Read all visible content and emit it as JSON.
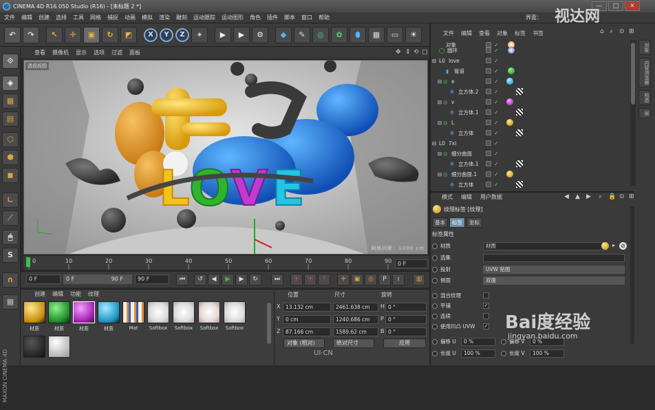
{
  "window": {
    "title": "CINEMA 4D R16.050 Studio (R16) - [未标题 2 *]",
    "min_label": "—",
    "max_label": "□",
    "close_label": "✕"
  },
  "menubar": [
    "文件",
    "编辑",
    "创建",
    "选择",
    "工具",
    "网格",
    "捕捉",
    "动画",
    "模拟",
    "渲染",
    "雕刻",
    "运动跟踪",
    "运动图形",
    "角色",
    "插件",
    "脚本",
    "窗口",
    "帮助"
  ],
  "menubar_right": "界面：",
  "toolbar": {
    "icons": [
      "undo-icon",
      "arrow-icon",
      "move-icon",
      "scale-icon",
      "rotate-icon",
      "live-select-icon",
      "x-axis-icon",
      "y-axis-icon",
      "z-axis-icon",
      "world-coord-icon",
      "render-view-icon",
      "render-picture-icon",
      "render-settings-icon",
      "cube-icon",
      "pen-icon",
      "subdivision-icon",
      "array-icon",
      "deformer-icon",
      "floor-icon",
      "camera-icon",
      "light-icon"
    ],
    "x_label": "X",
    "y_label": "Y",
    "z_label": "Z"
  },
  "viewport": {
    "menu": [
      "查看",
      "摄像机",
      "显示",
      "选项",
      "过滤",
      "面板"
    ],
    "label": "透视视图",
    "distance": "网格间距：1000 cm",
    "scene_text_top": "七夕",
    "scene_text_main": "LOVE",
    "letter_colors": {
      "L": "#f2c419",
      "O": "#2fb330",
      "V": "#c03ad0",
      "E": "#24c4e6"
    }
  },
  "timeline": {
    "ticks": [
      "0",
      "10",
      "20",
      "30",
      "40",
      "50",
      "60",
      "70",
      "80",
      "90"
    ],
    "frame_field": "0 F"
  },
  "transport": {
    "start": "0 F",
    "slider": "0 F",
    "slider_end": "90 F",
    "end": "90 F"
  },
  "materials": {
    "menu": [
      "创建",
      "编辑",
      "功能",
      "纹理"
    ],
    "items": [
      {
        "label": "材质",
        "color": "#e7b320"
      },
      {
        "label": "材质",
        "color": "#2fa83a"
      },
      {
        "label": "材质",
        "color": "#c02ec8"
      },
      {
        "label": "材质",
        "color": "#1fb0e0"
      },
      {
        "label": "Mat",
        "color": "#ddd"
      },
      {
        "label": "Softbox",
        "color": "#f0f0f0"
      },
      {
        "label": "Softbox",
        "color": "#f0f0f0"
      },
      {
        "label": "Softbox",
        "color": "#f2e8e8"
      },
      {
        "label": "Softbox",
        "color": "#f0f0f0"
      }
    ]
  },
  "coords": {
    "headers": [
      "位置",
      "尺寸",
      "旋转"
    ],
    "rows": [
      {
        "axis": "X",
        "pos": "13.132 cm",
        "size": "2461.638 cm",
        "rot_axis": "H",
        "rot": "0 °"
      },
      {
        "axis": "Y",
        "pos": "0 cm",
        "size": "1240.686 cm",
        "rot_axis": "P",
        "rot": "0 °"
      },
      {
        "axis": "Z",
        "pos": "87.166 cm",
        "size": "1589.62 cm",
        "rot_axis": "B",
        "rot": "0 °"
      }
    ],
    "mode1": "对象 (相对)",
    "mode2": "绝对尺寸",
    "apply": "应用"
  },
  "objects": {
    "menu": [
      "文件",
      "编辑",
      "查看",
      "对象",
      "标签",
      "书签"
    ],
    "tree": [
      {
        "name": "对象",
        "indent": 2
      },
      {
        "name": "圆环",
        "indent": 2
      },
      {
        "name": "love",
        "indent": 0
      },
      {
        "name": "管道",
        "indent": 2
      },
      {
        "name": "e",
        "indent": 1
      },
      {
        "name": "立方体.2",
        "indent": 3
      },
      {
        "name": "v",
        "indent": 1
      },
      {
        "name": "立方体.1",
        "indent": 3
      },
      {
        "name": "L",
        "indent": 1
      },
      {
        "name": "立方体",
        "indent": 3
      },
      {
        "name": "7xi",
        "indent": 0
      },
      {
        "name": "细分曲面",
        "indent": 1
      },
      {
        "name": "立方体.1",
        "indent": 3
      },
      {
        "name": "细分曲面.1",
        "indent": 1
      },
      {
        "name": "立方体",
        "indent": 3
      }
    ],
    "side_tabs": [
      "对象",
      "内容浏览器",
      "构造",
      "层"
    ]
  },
  "attributes": {
    "menu": [
      "模式",
      "编辑",
      "用户数据"
    ],
    "title": "纹理标签 [纹理]",
    "tabs": [
      "基本",
      "标签",
      "坐标"
    ],
    "section": "标签属性",
    "props": [
      {
        "label": "材质",
        "value": "材质"
      },
      {
        "label": "选集",
        "value": ""
      },
      {
        "label": "投射",
        "value": "UVW 贴图"
      },
      {
        "label": "侧面",
        "value": "双面"
      },
      {
        "label": "混合纹理",
        "value": ""
      },
      {
        "label": "平铺",
        "value": "✓"
      },
      {
        "label": "连续",
        "value": ""
      },
      {
        "label": "使用凹凸 UVW",
        "value": "✓"
      }
    ],
    "offset_u_label": "偏移 U",
    "offset_u": "0 %",
    "offset_v_label": "偏移 V",
    "offset_v": "0 %",
    "length_u_label": "长度 U",
    "length_u": "100 %",
    "length_v_label": "长度 V",
    "length_v": "100 %"
  },
  "watermarks": {
    "top_right": "视达网",
    "baidu": "Bai度经验",
    "baidu_url": "jingyan.baidu.com",
    "uicn": "UI·CN"
  }
}
